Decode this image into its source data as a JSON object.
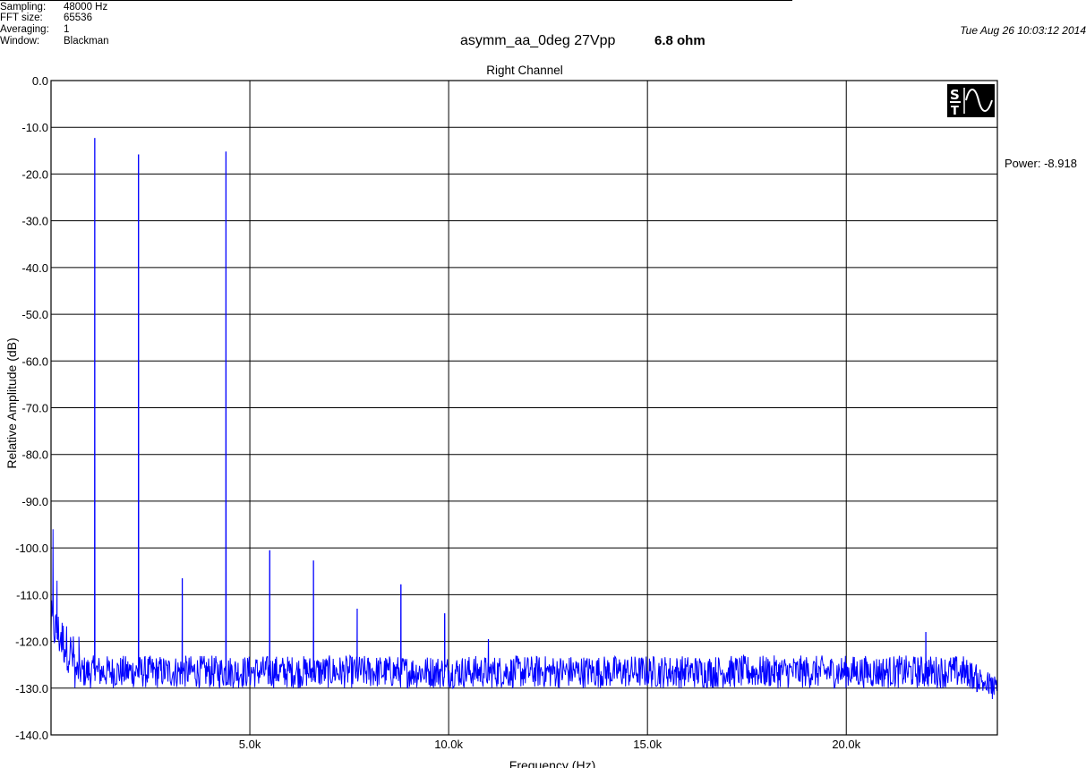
{
  "header": {
    "info": [
      {
        "key": "Sampling:",
        "value": "48000 Hz"
      },
      {
        "key": "FFT size:",
        "value": "65536"
      },
      {
        "key": "Averaging:",
        "value": "1"
      },
      {
        "key": "Window:",
        "value": "Blackman"
      }
    ],
    "title": "asymm_aa_0deg 27Vpp",
    "impedance": "6.8 ohm",
    "date": "Tue Aug 26 10:03:12 2014",
    "power": "Power: -8.918",
    "logo_icon": "st-sine-logo-icon"
  },
  "chart_data": {
    "type": "line",
    "title": "Right Channel",
    "xlabel": "Frequency (Hz)",
    "ylabel": "Relative Amplitude (dB)",
    "xlim": [
      0,
      23800
    ],
    "ylim": [
      -140,
      0
    ],
    "grid": true,
    "y_ticks": [
      "0.0",
      "-10.0",
      "-20.0",
      "-30.0",
      "-40.0",
      "-50.0",
      "-60.0",
      "-70.0",
      "-80.0",
      "-90.0",
      "-100.0",
      "-110.0",
      "-120.0",
      "-130.0",
      "-140.0"
    ],
    "y_tick_values": [
      0,
      -10,
      -20,
      -30,
      -40,
      -50,
      -60,
      -70,
      -80,
      -90,
      -100,
      -110,
      -120,
      -130,
      -140
    ],
    "x_ticks": [
      "5.0k",
      "10.0k",
      "15.0k",
      "20.0k"
    ],
    "x_tick_values": [
      5000,
      10000,
      15000,
      20000
    ],
    "line_color": "#0000ff",
    "noise_floor_db": -126.5,
    "low_frequency": [
      {
        "x": 50,
        "y": -96
      },
      {
        "x": 150,
        "y": -107
      },
      {
        "x": 250,
        "y": -118
      },
      {
        "x": 700,
        "y": -119
      }
    ],
    "peaks": [
      {
        "x": 1100,
        "y": -12.3
      },
      {
        "x": 2200,
        "y": -15.8
      },
      {
        "x": 3300,
        "y": -106.5
      },
      {
        "x": 4400,
        "y": -15.2
      },
      {
        "x": 5500,
        "y": -100.5
      },
      {
        "x": 6600,
        "y": -102.7
      },
      {
        "x": 7700,
        "y": -113
      },
      {
        "x": 8800,
        "y": -107.8
      },
      {
        "x": 9900,
        "y": -114
      },
      {
        "x": 11000,
        "y": -119.5
      },
      {
        "x": 22000,
        "y": -118
      }
    ]
  }
}
